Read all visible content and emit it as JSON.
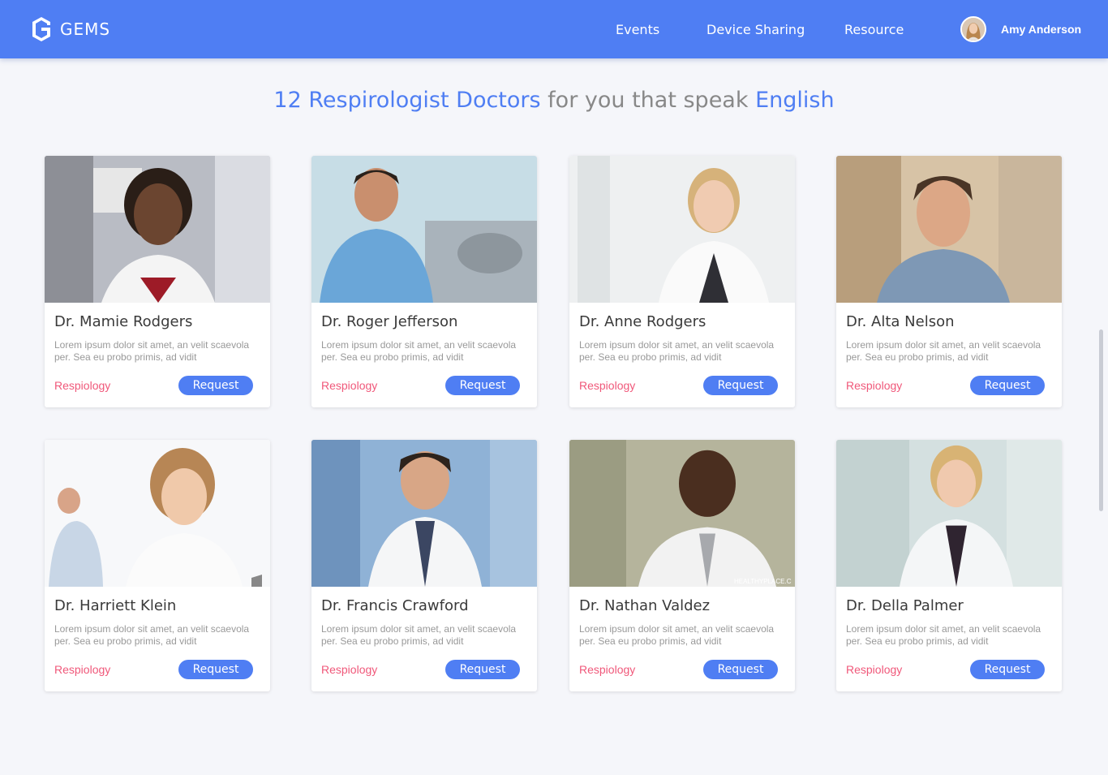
{
  "nav": {
    "brand": "GEMS",
    "links": [
      "Events",
      "Device Sharing",
      "Resource"
    ],
    "user_name": "Amy Anderson"
  },
  "heading": {
    "count_specialty": "12 Respirologist Doctors",
    "middle": "for you that speak",
    "language": "English"
  },
  "colors": {
    "primary": "#4f7ef3",
    "specialty": "#f0587a",
    "background": "#f5f6fa"
  },
  "cards": [
    {
      "name": "Dr. Mamie Rodgers",
      "description": "Lorem ipsum dolor sit amet, an velit scaevola per. Sea eu probo primis, ad vidit",
      "specialty": "Respiology",
      "button": "Request"
    },
    {
      "name": "Dr. Roger Jefferson",
      "description": "Lorem ipsum dolor sit amet, an velit scaevola per. Sea eu probo primis, ad vidit",
      "specialty": "Respiology",
      "button": "Request"
    },
    {
      "name": "Dr. Anne Rodgers",
      "description": "Lorem ipsum dolor sit amet, an velit scaevola per. Sea eu probo primis, ad vidit",
      "specialty": "Respiology",
      "button": "Request"
    },
    {
      "name": "Dr. Alta Nelson",
      "description": "Lorem ipsum dolor sit amet, an velit scaevola per. Sea eu probo primis, ad vidit",
      "specialty": "Respiology",
      "button": "Request"
    },
    {
      "name": "Dr. Harriett Klein",
      "description": "Lorem ipsum dolor sit amet, an velit scaevola per. Sea eu probo primis, ad vidit",
      "specialty": "Respiology",
      "button": "Request"
    },
    {
      "name": "Dr. Francis Crawford",
      "description": "Lorem ipsum dolor sit amet, an velit scaevola per. Sea eu probo primis, ad vidit",
      "specialty": "Respiology",
      "button": "Request"
    },
    {
      "name": "Dr. Nathan Valdez",
      "description": "Lorem ipsum dolor sit amet, an velit scaevola per. Sea eu probo primis, ad vidit",
      "specialty": "Respiology",
      "button": "Request",
      "photo_watermark": "HEALTHYPLACE.C"
    },
    {
      "name": "Dr. Della Palmer",
      "description": "Lorem ipsum dolor sit amet, an velit scaevola per. Sea eu probo primis, ad vidit",
      "specialty": "Respiology",
      "button": "Request"
    }
  ]
}
